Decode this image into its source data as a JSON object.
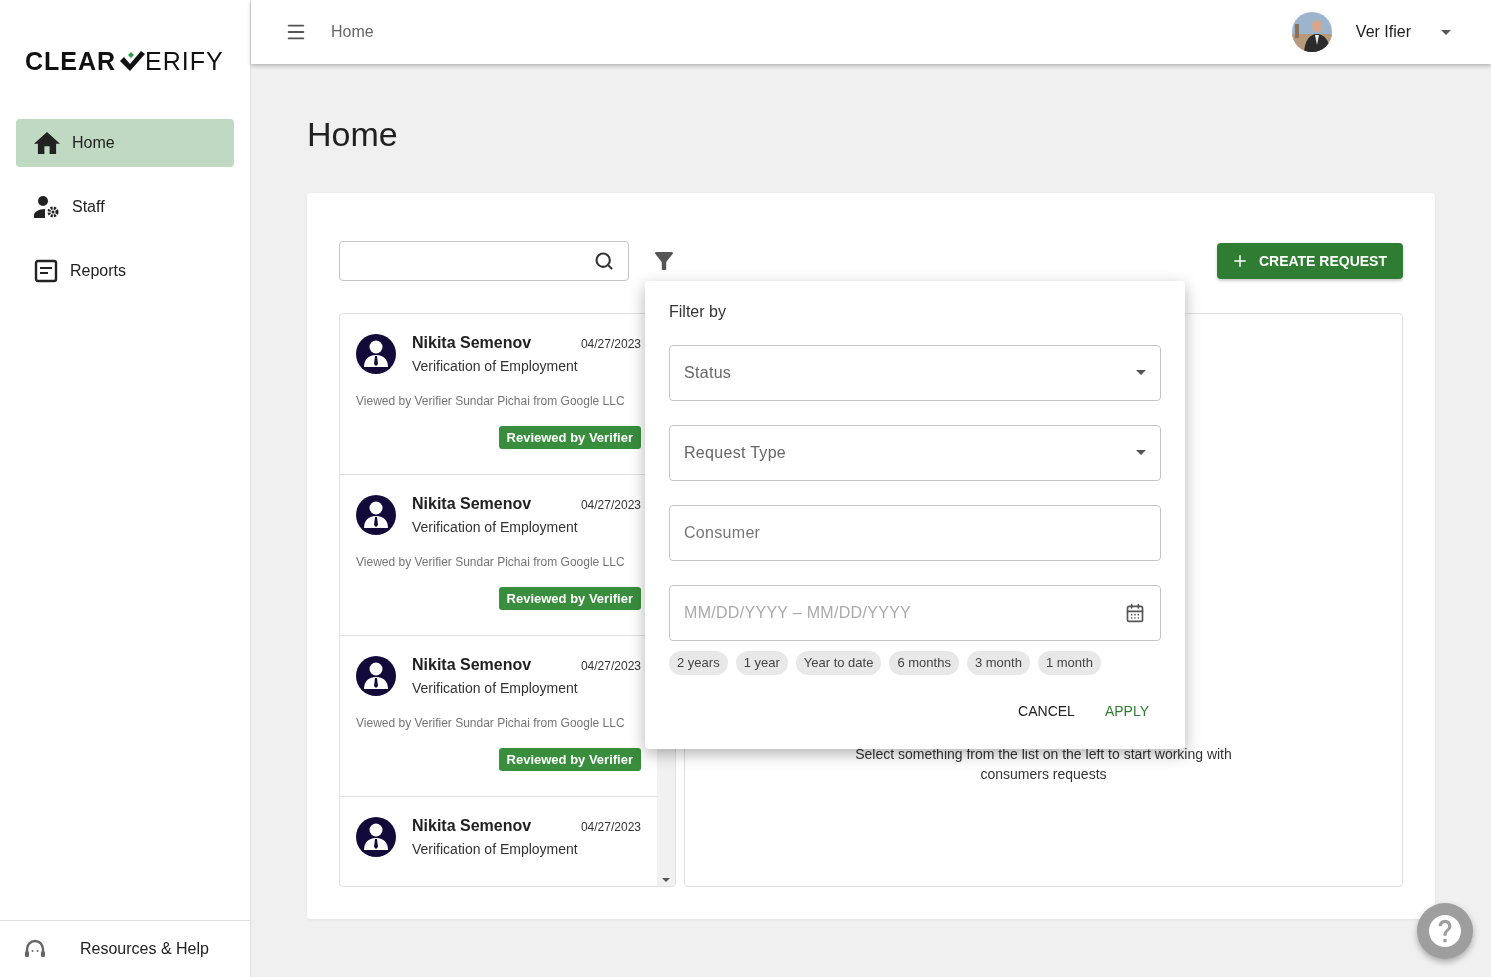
{
  "brand": {
    "left": "CLEAR",
    "right": "ERIFY"
  },
  "sidebar": {
    "items": [
      {
        "label": "Home",
        "kind": "home",
        "selected": true
      },
      {
        "label": "Staff",
        "kind": "staff",
        "selected": false
      },
      {
        "label": "Reports",
        "kind": "reports",
        "selected": false
      }
    ],
    "footer": {
      "label": "Resources & Help"
    }
  },
  "topbar": {
    "breadcrumb": "Home",
    "user": {
      "name": "Ver Ifier"
    }
  },
  "page": {
    "title": "Home"
  },
  "create_button": "CREATE REQUEST",
  "requests": [
    {
      "name": "Nikita Semenov",
      "date": "04/27/2023",
      "type": "Verification of Employment",
      "viewed": "Viewed by Verifier Sundar Pichai from Google LLC",
      "status": "Reviewed by Verifier"
    },
    {
      "name": "Nikita Semenov",
      "date": "04/27/2023",
      "type": "Verification of Employment",
      "viewed": "Viewed by Verifier Sundar Pichai from Google LLC",
      "status": "Reviewed by Verifier"
    },
    {
      "name": "Nikita Semenov",
      "date": "04/27/2023",
      "type": "Verification of Employment",
      "viewed": "Viewed by Verifier Sundar Pichai from Google LLC",
      "status": "Reviewed by Verifier"
    },
    {
      "name": "Nikita Semenov",
      "date": "04/27/2023",
      "type": "Verification of Employment"
    }
  ],
  "empty_state": "Select something from the list on the left to start working with consumers requests",
  "filter": {
    "title": "Filter by",
    "fields": [
      {
        "kind": "select",
        "label": "Status"
      },
      {
        "kind": "select",
        "label": "Request Type"
      },
      {
        "kind": "text",
        "placeholder": "Consumer"
      },
      {
        "kind": "date",
        "placeholder": "MM/DD/YYYY – MM/DD/YYYY"
      }
    ],
    "chips": [
      "2 years",
      "1 year",
      "Year to date",
      "6 months",
      "3 month",
      "1 month"
    ],
    "actions": [
      {
        "label": "CANCEL",
        "kind": "cancel"
      },
      {
        "label": "APPLY",
        "kind": "apply"
      }
    ]
  }
}
